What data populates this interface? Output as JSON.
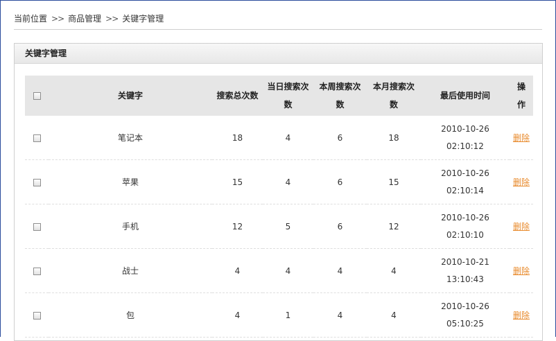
{
  "breadcrumb": {
    "items": [
      "当前位置",
      "商品管理",
      "关键字管理"
    ],
    "separator": ">>"
  },
  "panel": {
    "title": "关键字管理"
  },
  "table": {
    "headers": {
      "keyword": "关键字",
      "total": "搜索总次数",
      "today": "当日搜索次数",
      "week": "本周搜索次数",
      "month": "本月搜索次数",
      "last_used": "最后使用时间",
      "action": "操作"
    },
    "rows": [
      {
        "keyword": "笔记本",
        "total": "18",
        "today": "4",
        "week": "6",
        "month": "18",
        "date": "2010-10-26",
        "time": "02:10:12",
        "action": "删除"
      },
      {
        "keyword": "苹果",
        "total": "15",
        "today": "4",
        "week": "6",
        "month": "15",
        "date": "2010-10-26",
        "time": "02:10:14",
        "action": "删除"
      },
      {
        "keyword": "手机",
        "total": "12",
        "today": "5",
        "week": "6",
        "month": "12",
        "date": "2010-10-26",
        "time": "02:10:10",
        "action": "删除"
      },
      {
        "keyword": "战士",
        "total": "4",
        "today": "4",
        "week": "4",
        "month": "4",
        "date": "2010-10-21",
        "time": "13:10:43",
        "action": "删除"
      },
      {
        "keyword": "包",
        "total": "4",
        "today": "1",
        "week": "4",
        "month": "4",
        "date": "2010-10-26",
        "time": "05:10:25",
        "action": "删除"
      }
    ]
  },
  "colors": {
    "frame": "#2a4b9b",
    "header_bg": "#e6e6e6",
    "link": "#e88a2c"
  }
}
